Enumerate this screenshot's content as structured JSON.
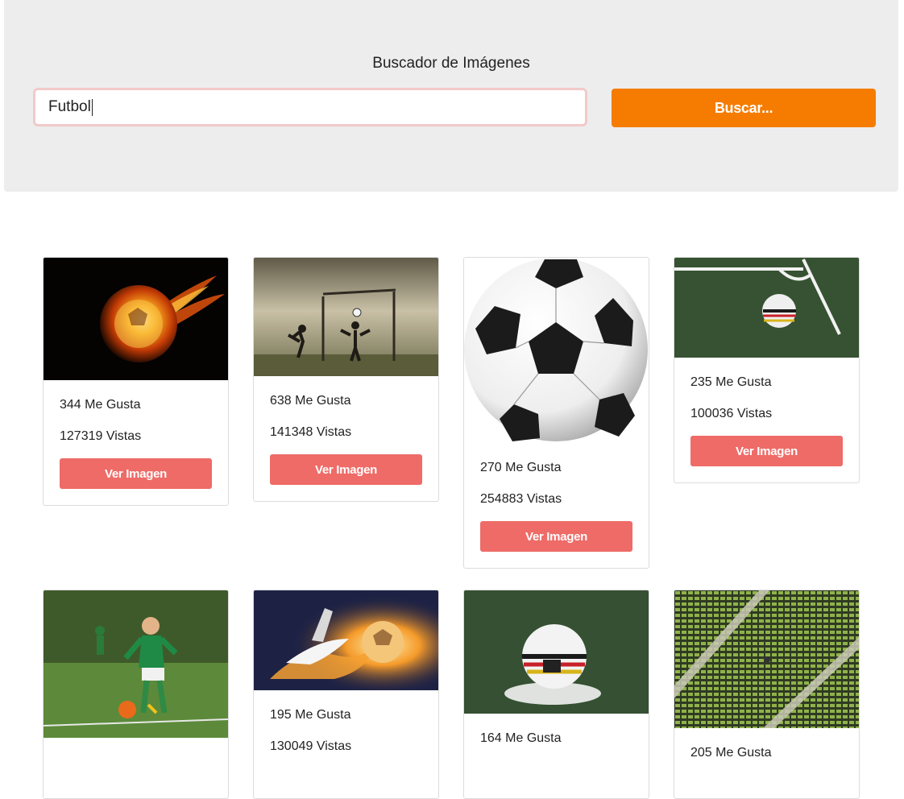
{
  "header": {
    "title": "Buscador de Imágenes",
    "search_value": "Futbol",
    "search_button": "Buscar..."
  },
  "results": [
    {
      "likes": "344 Me Gusta",
      "views": "127319 Vistas",
      "button": "Ver Imagen",
      "image": "fire-soccer-ball"
    },
    {
      "likes": "638 Me Gusta",
      "views": "141348 Vistas",
      "button": "Ver Imagen",
      "image": "kids-playing-goal-mist"
    },
    {
      "likes": "270 Me Gusta",
      "views": "254883 Vistas",
      "button": "Ver Imagen",
      "image": "classic-soccer-ball"
    },
    {
      "likes": "235 Me Gusta",
      "views": "100036 Vistas",
      "button": "Ver Imagen",
      "image": "ball-on-corner-line"
    },
    {
      "likes": "",
      "views": "",
      "button": "",
      "image": "boy-green-kit-kicking"
    },
    {
      "likes": "195 Me Gusta",
      "views": "130049 Vistas",
      "button": "",
      "image": "flaming-boot-and-ball"
    },
    {
      "likes": "164 Me Gusta",
      "views": "",
      "button": "",
      "image": "ball-on-penalty-spot"
    },
    {
      "likes": "205 Me Gusta",
      "views": "",
      "button": "",
      "image": "green-stadium-seats"
    }
  ],
  "colors": {
    "search_button": "#f57c00",
    "card_button": "#ee6b67",
    "jumbotron": "#ededed"
  }
}
